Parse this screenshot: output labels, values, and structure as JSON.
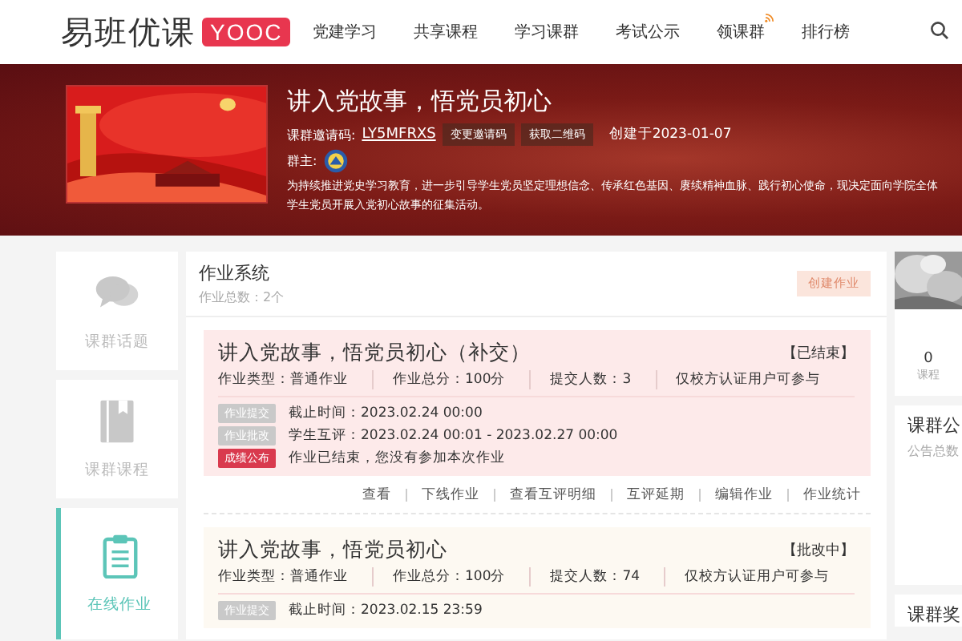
{
  "header": {
    "logo": "易班优课",
    "logo_badge": "YOOC",
    "nav": [
      {
        "label": "党建学习",
        "kind": "plain"
      },
      {
        "label": "共享课程",
        "kind": "plain"
      },
      {
        "label": "学习课群",
        "kind": "plain"
      },
      {
        "label": "考试公示",
        "kind": "plain"
      },
      {
        "label": "领课群",
        "kind": "signal"
      },
      {
        "label": "排行榜",
        "kind": "plain"
      }
    ]
  },
  "banner": {
    "title": "讲入党故事，悟党员初心",
    "invite_label": "课群邀请码:",
    "invite_code": "LY5MFRXS",
    "buttons": [
      "变更邀请码",
      "获取二维码"
    ],
    "created": "创建于2023-01-07",
    "owner_label": "群主:",
    "description": "为持续推进党史学习教育，进一步引导学生党员坚定理想信念、传承红色基因、赓续精神血脉、践行初心使命，现决定面向学院全体学生党员开展入党初心故事的征集活动。"
  },
  "sidebar": {
    "items": [
      {
        "label": "课群话题",
        "kind": "chat",
        "selected": false
      },
      {
        "label": "课群课程",
        "kind": "book",
        "selected": false
      },
      {
        "label": "在线作业",
        "kind": "clipboard",
        "selected": true
      }
    ]
  },
  "panel": {
    "title": "作业系统",
    "count": "作业总数：2个",
    "create_button": "创建作业"
  },
  "assignments": [
    {
      "title": "讲入党故事，悟党员初心（补交）",
      "status": "【已结束】",
      "kind": "ended",
      "meta": [
        "作业类型：普通作业",
        "作业总分：100分",
        "提交人数：3",
        "仅校方认证用户可参与"
      ],
      "steps": [
        {
          "tag": "作业提交",
          "text": "截止时间：2023.02.24 00:00",
          "active": false
        },
        {
          "tag": "作业批改",
          "text": "学生互评：2023.02.24 00:01 - 2023.02.27 00:00",
          "active": false
        },
        {
          "tag": "成绩公布",
          "text": "作业已结束，您没有参加本次作业",
          "active": true
        }
      ],
      "actions": [
        "查看",
        "下线作业",
        "查看互评明细",
        "互评延期",
        "编辑作业",
        "作业统计"
      ]
    },
    {
      "title": "讲入党故事，悟党员初心",
      "status": "【批改中】",
      "kind": "grading",
      "meta": [
        "作业类型：普通作业",
        "作业总分：100分",
        "提交人数：74",
        "仅校方认证用户可参与"
      ],
      "steps": [
        {
          "tag": "作业提交",
          "text": "截止时间：2023.02.15 23:59",
          "active": false
        }
      ]
    }
  ],
  "right": {
    "stat_value": "0",
    "stat_label": "课程",
    "notice_title": "课群公",
    "notice_count": "公告总数",
    "reward_title": "课群奖"
  }
}
